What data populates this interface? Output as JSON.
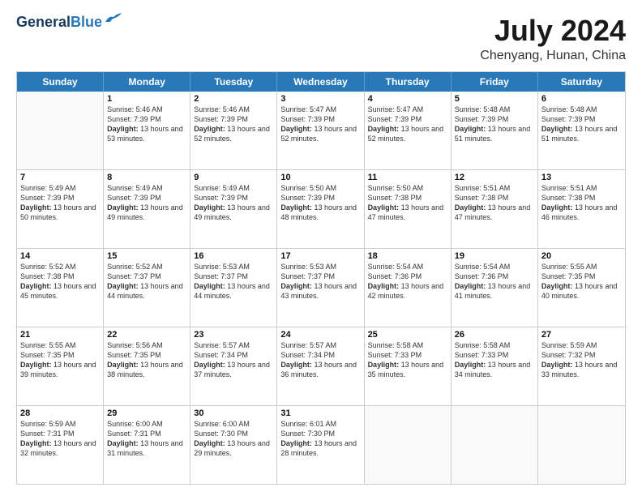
{
  "header": {
    "logo_line1": "General",
    "logo_line2": "Blue",
    "month_year": "July 2024",
    "location": "Chenyang, Hunan, China"
  },
  "weekdays": [
    "Sunday",
    "Monday",
    "Tuesday",
    "Wednesday",
    "Thursday",
    "Friday",
    "Saturday"
  ],
  "rows": [
    [
      {
        "day": "",
        "sunrise": "",
        "sunset": "",
        "daylight": ""
      },
      {
        "day": "1",
        "sunrise": "Sunrise: 5:46 AM",
        "sunset": "Sunset: 7:39 PM",
        "daylight": "Daylight: 13 hours and 53 minutes."
      },
      {
        "day": "2",
        "sunrise": "Sunrise: 5:46 AM",
        "sunset": "Sunset: 7:39 PM",
        "daylight": "Daylight: 13 hours and 52 minutes."
      },
      {
        "day": "3",
        "sunrise": "Sunrise: 5:47 AM",
        "sunset": "Sunset: 7:39 PM",
        "daylight": "Daylight: 13 hours and 52 minutes."
      },
      {
        "day": "4",
        "sunrise": "Sunrise: 5:47 AM",
        "sunset": "Sunset: 7:39 PM",
        "daylight": "Daylight: 13 hours and 52 minutes."
      },
      {
        "day": "5",
        "sunrise": "Sunrise: 5:48 AM",
        "sunset": "Sunset: 7:39 PM",
        "daylight": "Daylight: 13 hours and 51 minutes."
      },
      {
        "day": "6",
        "sunrise": "Sunrise: 5:48 AM",
        "sunset": "Sunset: 7:39 PM",
        "daylight": "Daylight: 13 hours and 51 minutes."
      }
    ],
    [
      {
        "day": "7",
        "sunrise": "Sunrise: 5:49 AM",
        "sunset": "Sunset: 7:39 PM",
        "daylight": "Daylight: 13 hours and 50 minutes."
      },
      {
        "day": "8",
        "sunrise": "Sunrise: 5:49 AM",
        "sunset": "Sunset: 7:39 PM",
        "daylight": "Daylight: 13 hours and 49 minutes."
      },
      {
        "day": "9",
        "sunrise": "Sunrise: 5:49 AM",
        "sunset": "Sunset: 7:39 PM",
        "daylight": "Daylight: 13 hours and 49 minutes."
      },
      {
        "day": "10",
        "sunrise": "Sunrise: 5:50 AM",
        "sunset": "Sunset: 7:39 PM",
        "daylight": "Daylight: 13 hours and 48 minutes."
      },
      {
        "day": "11",
        "sunrise": "Sunrise: 5:50 AM",
        "sunset": "Sunset: 7:38 PM",
        "daylight": "Daylight: 13 hours and 47 minutes."
      },
      {
        "day": "12",
        "sunrise": "Sunrise: 5:51 AM",
        "sunset": "Sunset: 7:38 PM",
        "daylight": "Daylight: 13 hours and 47 minutes."
      },
      {
        "day": "13",
        "sunrise": "Sunrise: 5:51 AM",
        "sunset": "Sunset: 7:38 PM",
        "daylight": "Daylight: 13 hours and 46 minutes."
      }
    ],
    [
      {
        "day": "14",
        "sunrise": "Sunrise: 5:52 AM",
        "sunset": "Sunset: 7:38 PM",
        "daylight": "Daylight: 13 hours and 45 minutes."
      },
      {
        "day": "15",
        "sunrise": "Sunrise: 5:52 AM",
        "sunset": "Sunset: 7:37 PM",
        "daylight": "Daylight: 13 hours and 44 minutes."
      },
      {
        "day": "16",
        "sunrise": "Sunrise: 5:53 AM",
        "sunset": "Sunset: 7:37 PM",
        "daylight": "Daylight: 13 hours and 44 minutes."
      },
      {
        "day": "17",
        "sunrise": "Sunrise: 5:53 AM",
        "sunset": "Sunset: 7:37 PM",
        "daylight": "Daylight: 13 hours and 43 minutes."
      },
      {
        "day": "18",
        "sunrise": "Sunrise: 5:54 AM",
        "sunset": "Sunset: 7:36 PM",
        "daylight": "Daylight: 13 hours and 42 minutes."
      },
      {
        "day": "19",
        "sunrise": "Sunrise: 5:54 AM",
        "sunset": "Sunset: 7:36 PM",
        "daylight": "Daylight: 13 hours and 41 minutes."
      },
      {
        "day": "20",
        "sunrise": "Sunrise: 5:55 AM",
        "sunset": "Sunset: 7:35 PM",
        "daylight": "Daylight: 13 hours and 40 minutes."
      }
    ],
    [
      {
        "day": "21",
        "sunrise": "Sunrise: 5:55 AM",
        "sunset": "Sunset: 7:35 PM",
        "daylight": "Daylight: 13 hours and 39 minutes."
      },
      {
        "day": "22",
        "sunrise": "Sunrise: 5:56 AM",
        "sunset": "Sunset: 7:35 PM",
        "daylight": "Daylight: 13 hours and 38 minutes."
      },
      {
        "day": "23",
        "sunrise": "Sunrise: 5:57 AM",
        "sunset": "Sunset: 7:34 PM",
        "daylight": "Daylight: 13 hours and 37 minutes."
      },
      {
        "day": "24",
        "sunrise": "Sunrise: 5:57 AM",
        "sunset": "Sunset: 7:34 PM",
        "daylight": "Daylight: 13 hours and 36 minutes."
      },
      {
        "day": "25",
        "sunrise": "Sunrise: 5:58 AM",
        "sunset": "Sunset: 7:33 PM",
        "daylight": "Daylight: 13 hours and 35 minutes."
      },
      {
        "day": "26",
        "sunrise": "Sunrise: 5:58 AM",
        "sunset": "Sunset: 7:33 PM",
        "daylight": "Daylight: 13 hours and 34 minutes."
      },
      {
        "day": "27",
        "sunrise": "Sunrise: 5:59 AM",
        "sunset": "Sunset: 7:32 PM",
        "daylight": "Daylight: 13 hours and 33 minutes."
      }
    ],
    [
      {
        "day": "28",
        "sunrise": "Sunrise: 5:59 AM",
        "sunset": "Sunset: 7:31 PM",
        "daylight": "Daylight: 13 hours and 32 minutes."
      },
      {
        "day": "29",
        "sunrise": "Sunrise: 6:00 AM",
        "sunset": "Sunset: 7:31 PM",
        "daylight": "Daylight: 13 hours and 31 minutes."
      },
      {
        "day": "30",
        "sunrise": "Sunrise: 6:00 AM",
        "sunset": "Sunset: 7:30 PM",
        "daylight": "Daylight: 13 hours and 29 minutes."
      },
      {
        "day": "31",
        "sunrise": "Sunrise: 6:01 AM",
        "sunset": "Sunset: 7:30 PM",
        "daylight": "Daylight: 13 hours and 28 minutes."
      },
      {
        "day": "",
        "sunrise": "",
        "sunset": "",
        "daylight": ""
      },
      {
        "day": "",
        "sunrise": "",
        "sunset": "",
        "daylight": ""
      },
      {
        "day": "",
        "sunrise": "",
        "sunset": "",
        "daylight": ""
      }
    ]
  ]
}
